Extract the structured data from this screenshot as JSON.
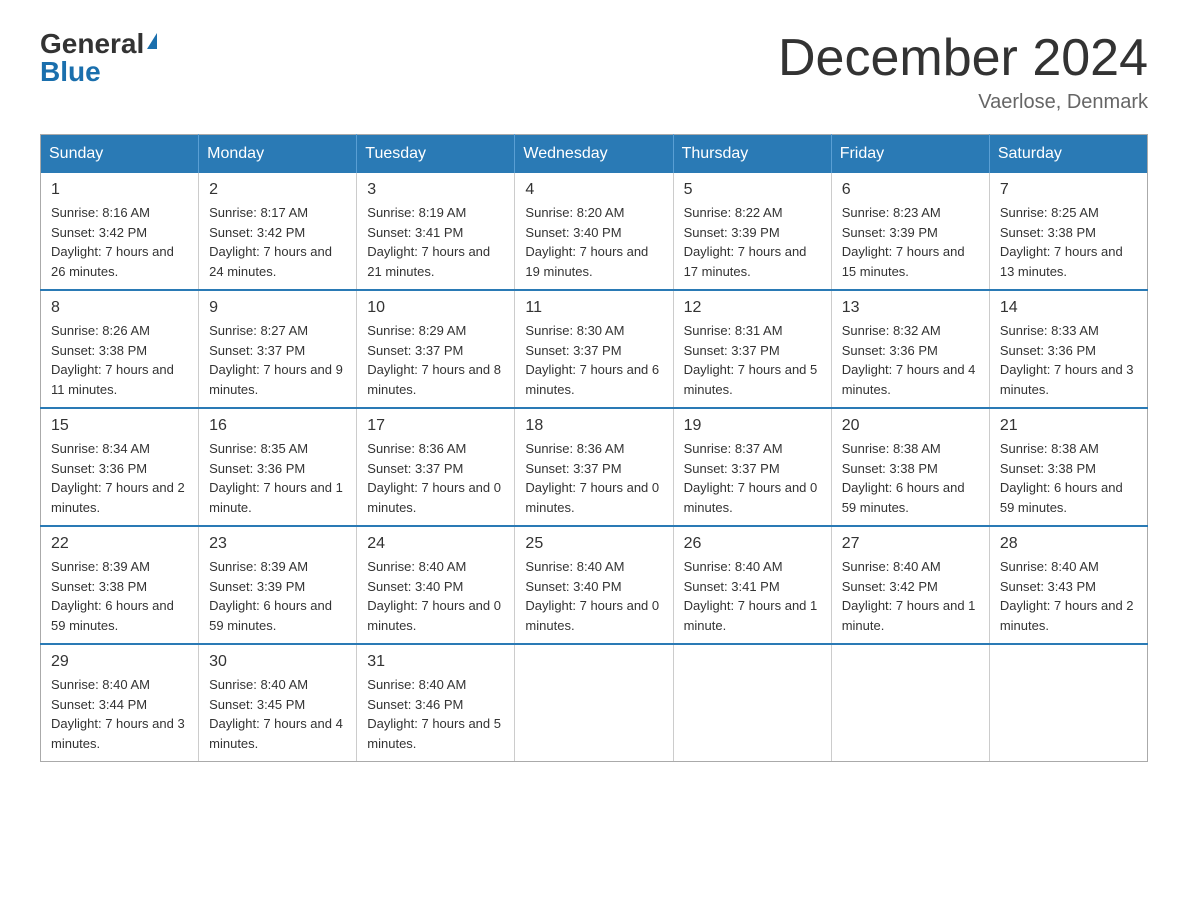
{
  "logo": {
    "general": "General",
    "blue": "Blue"
  },
  "title": "December 2024",
  "location": "Vaerlose, Denmark",
  "days_header": [
    "Sunday",
    "Monday",
    "Tuesday",
    "Wednesday",
    "Thursday",
    "Friday",
    "Saturday"
  ],
  "weeks": [
    [
      {
        "day": "1",
        "sunrise": "8:16 AM",
        "sunset": "3:42 PM",
        "daylight": "7 hours and 26 minutes."
      },
      {
        "day": "2",
        "sunrise": "8:17 AM",
        "sunset": "3:42 PM",
        "daylight": "7 hours and 24 minutes."
      },
      {
        "day": "3",
        "sunrise": "8:19 AM",
        "sunset": "3:41 PM",
        "daylight": "7 hours and 21 minutes."
      },
      {
        "day": "4",
        "sunrise": "8:20 AM",
        "sunset": "3:40 PM",
        "daylight": "7 hours and 19 minutes."
      },
      {
        "day": "5",
        "sunrise": "8:22 AM",
        "sunset": "3:39 PM",
        "daylight": "7 hours and 17 minutes."
      },
      {
        "day": "6",
        "sunrise": "8:23 AM",
        "sunset": "3:39 PM",
        "daylight": "7 hours and 15 minutes."
      },
      {
        "day": "7",
        "sunrise": "8:25 AM",
        "sunset": "3:38 PM",
        "daylight": "7 hours and 13 minutes."
      }
    ],
    [
      {
        "day": "8",
        "sunrise": "8:26 AM",
        "sunset": "3:38 PM",
        "daylight": "7 hours and 11 minutes."
      },
      {
        "day": "9",
        "sunrise": "8:27 AM",
        "sunset": "3:37 PM",
        "daylight": "7 hours and 9 minutes."
      },
      {
        "day": "10",
        "sunrise": "8:29 AM",
        "sunset": "3:37 PM",
        "daylight": "7 hours and 8 minutes."
      },
      {
        "day": "11",
        "sunrise": "8:30 AM",
        "sunset": "3:37 PM",
        "daylight": "7 hours and 6 minutes."
      },
      {
        "day": "12",
        "sunrise": "8:31 AM",
        "sunset": "3:37 PM",
        "daylight": "7 hours and 5 minutes."
      },
      {
        "day": "13",
        "sunrise": "8:32 AM",
        "sunset": "3:36 PM",
        "daylight": "7 hours and 4 minutes."
      },
      {
        "day": "14",
        "sunrise": "8:33 AM",
        "sunset": "3:36 PM",
        "daylight": "7 hours and 3 minutes."
      }
    ],
    [
      {
        "day": "15",
        "sunrise": "8:34 AM",
        "sunset": "3:36 PM",
        "daylight": "7 hours and 2 minutes."
      },
      {
        "day": "16",
        "sunrise": "8:35 AM",
        "sunset": "3:36 PM",
        "daylight": "7 hours and 1 minute."
      },
      {
        "day": "17",
        "sunrise": "8:36 AM",
        "sunset": "3:37 PM",
        "daylight": "7 hours and 0 minutes."
      },
      {
        "day": "18",
        "sunrise": "8:36 AM",
        "sunset": "3:37 PM",
        "daylight": "7 hours and 0 minutes."
      },
      {
        "day": "19",
        "sunrise": "8:37 AM",
        "sunset": "3:37 PM",
        "daylight": "7 hours and 0 minutes."
      },
      {
        "day": "20",
        "sunrise": "8:38 AM",
        "sunset": "3:38 PM",
        "daylight": "6 hours and 59 minutes."
      },
      {
        "day": "21",
        "sunrise": "8:38 AM",
        "sunset": "3:38 PM",
        "daylight": "6 hours and 59 minutes."
      }
    ],
    [
      {
        "day": "22",
        "sunrise": "8:39 AM",
        "sunset": "3:38 PM",
        "daylight": "6 hours and 59 minutes."
      },
      {
        "day": "23",
        "sunrise": "8:39 AM",
        "sunset": "3:39 PM",
        "daylight": "6 hours and 59 minutes."
      },
      {
        "day": "24",
        "sunrise": "8:40 AM",
        "sunset": "3:40 PM",
        "daylight": "7 hours and 0 minutes."
      },
      {
        "day": "25",
        "sunrise": "8:40 AM",
        "sunset": "3:40 PM",
        "daylight": "7 hours and 0 minutes."
      },
      {
        "day": "26",
        "sunrise": "8:40 AM",
        "sunset": "3:41 PM",
        "daylight": "7 hours and 1 minute."
      },
      {
        "day": "27",
        "sunrise": "8:40 AM",
        "sunset": "3:42 PM",
        "daylight": "7 hours and 1 minute."
      },
      {
        "day": "28",
        "sunrise": "8:40 AM",
        "sunset": "3:43 PM",
        "daylight": "7 hours and 2 minutes."
      }
    ],
    [
      {
        "day": "29",
        "sunrise": "8:40 AM",
        "sunset": "3:44 PM",
        "daylight": "7 hours and 3 minutes."
      },
      {
        "day": "30",
        "sunrise": "8:40 AM",
        "sunset": "3:45 PM",
        "daylight": "7 hours and 4 minutes."
      },
      {
        "day": "31",
        "sunrise": "8:40 AM",
        "sunset": "3:46 PM",
        "daylight": "7 hours and 5 minutes."
      },
      null,
      null,
      null,
      null
    ]
  ]
}
